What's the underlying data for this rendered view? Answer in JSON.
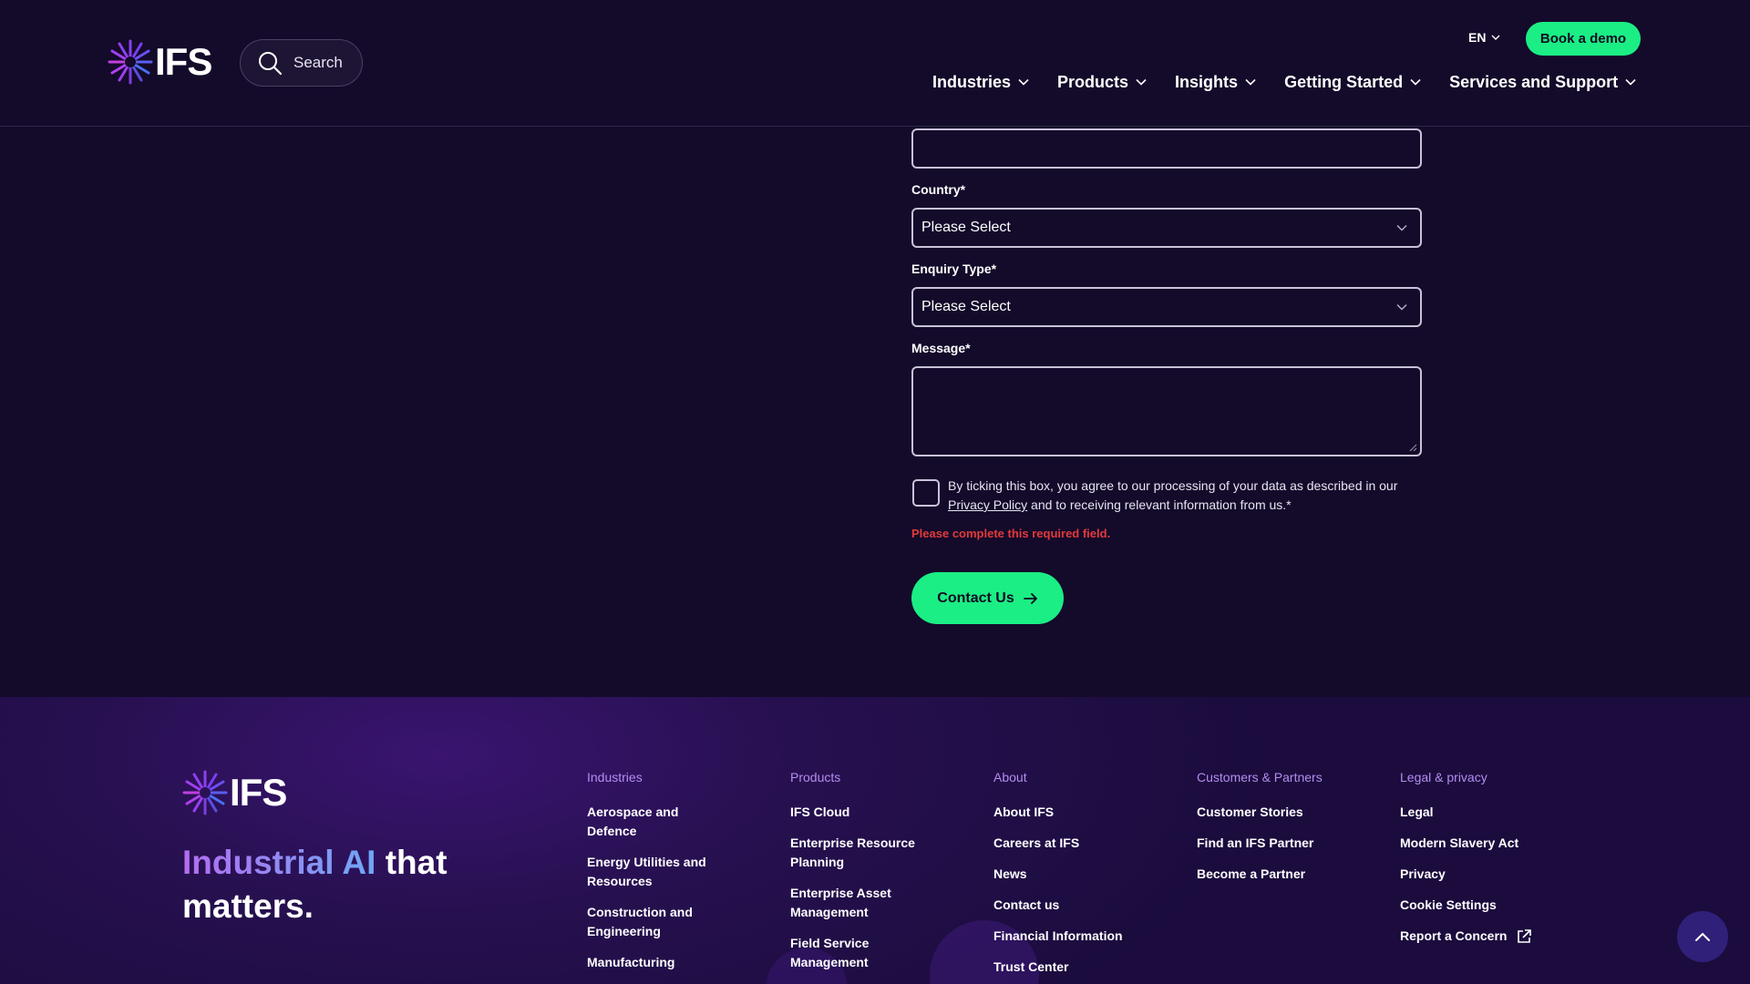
{
  "header": {
    "logo_text": "IFS",
    "search_label": "Search",
    "language": "EN",
    "book_demo": "Book a demo",
    "nav": [
      {
        "label": "Industries"
      },
      {
        "label": "Products"
      },
      {
        "label": "Insights"
      },
      {
        "label": "Getting Started"
      },
      {
        "label": "Services and Support"
      }
    ]
  },
  "form": {
    "top_field_value": "",
    "country_label": "Country*",
    "country_value": "Please Select",
    "enquiry_label": "Enquiry Type*",
    "enquiry_value": "Please Select",
    "message_label": "Message*",
    "message_value": "",
    "consent_text_before": "By ticking this box, you agree to our processing of your data as described in our ",
    "consent_link": "Privacy Policy",
    "consent_text_after": " and to receiving relevant information from us.*",
    "consent_checked": false,
    "error": "Please complete this required field.",
    "submit": "Contact Us"
  },
  "footer": {
    "logo_text": "IFS",
    "tagline_accent": "Industrial AI",
    "tagline_rest": " that matters.",
    "columns": [
      {
        "heading": "Industries",
        "links": [
          "Aerospace and Defence",
          "Energy Utilities and Resources",
          "Construction and Engineering",
          "Manufacturing"
        ]
      },
      {
        "heading": "Products",
        "links": [
          "IFS Cloud",
          "Enterprise Resource Planning",
          "Enterprise Asset Management",
          "Field Service Management"
        ]
      },
      {
        "heading": "About",
        "links": [
          "About IFS",
          "Careers at IFS",
          "News",
          "Contact us",
          "Financial Information",
          "Trust Center"
        ]
      },
      {
        "heading": "Customers & Partners",
        "links": [
          "Customer Stories",
          "Find an IFS Partner",
          "Become a Partner"
        ]
      },
      {
        "heading": "Legal & privacy",
        "links": [
          "Legal",
          "Modern Slavery Act",
          "Privacy",
          "Cookie Settings",
          "Report a Concern"
        ]
      }
    ]
  },
  "colors": {
    "background": "#140a2a",
    "accent_green": "#1bee84",
    "error_red": "#e23a3a",
    "footer_heading": "#b48cf0"
  },
  "icons": {
    "search": "search-icon",
    "chevron": "chevron-down-icon",
    "arrow": "arrow-right-icon",
    "external": "external-link-icon",
    "up": "chevron-up-icon"
  }
}
